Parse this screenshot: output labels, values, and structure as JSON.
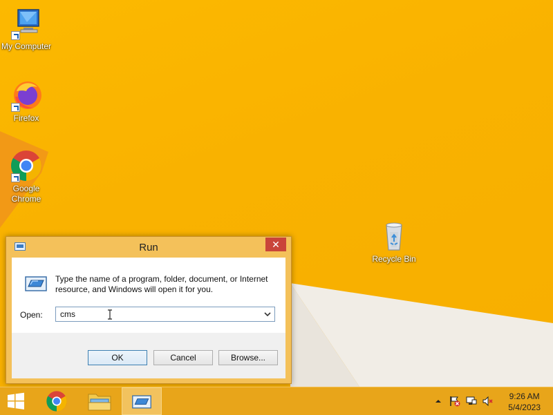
{
  "desktop": {
    "icons": [
      {
        "label": "My Computer",
        "icon": "computer-icon"
      },
      {
        "label": "Firefox",
        "icon": "firefox-icon"
      },
      {
        "label": "Google Chrome",
        "icon": "chrome-icon"
      },
      {
        "label": "Recycle Bin",
        "icon": "recycle-bin-icon"
      }
    ]
  },
  "run_dialog": {
    "title": "Run",
    "close_label": "✕",
    "description": "Type the name of a program, folder, document, or Internet resource, and Windows will open it for you.",
    "open_label": "Open:",
    "open_value": "cms",
    "ok_label": "OK",
    "cancel_label": "Cancel",
    "browse_label": "Browse..."
  },
  "taskbar": {
    "items": [
      "start-icon",
      "chrome-icon",
      "file-explorer-icon",
      "run-icon"
    ],
    "tray": [
      "show-hidden-icons-icon",
      "action-center-flag-icon",
      "network-icon",
      "volume-muted-icon"
    ],
    "clock": {
      "time": "9:26 AM",
      "date": "5/4/2023"
    }
  },
  "colors": {
    "desktop_bg": "#f9b200",
    "taskbar_bg": "#e8a51a",
    "dialog_frame": "#f4c15a",
    "close_button": "#c9453a"
  }
}
